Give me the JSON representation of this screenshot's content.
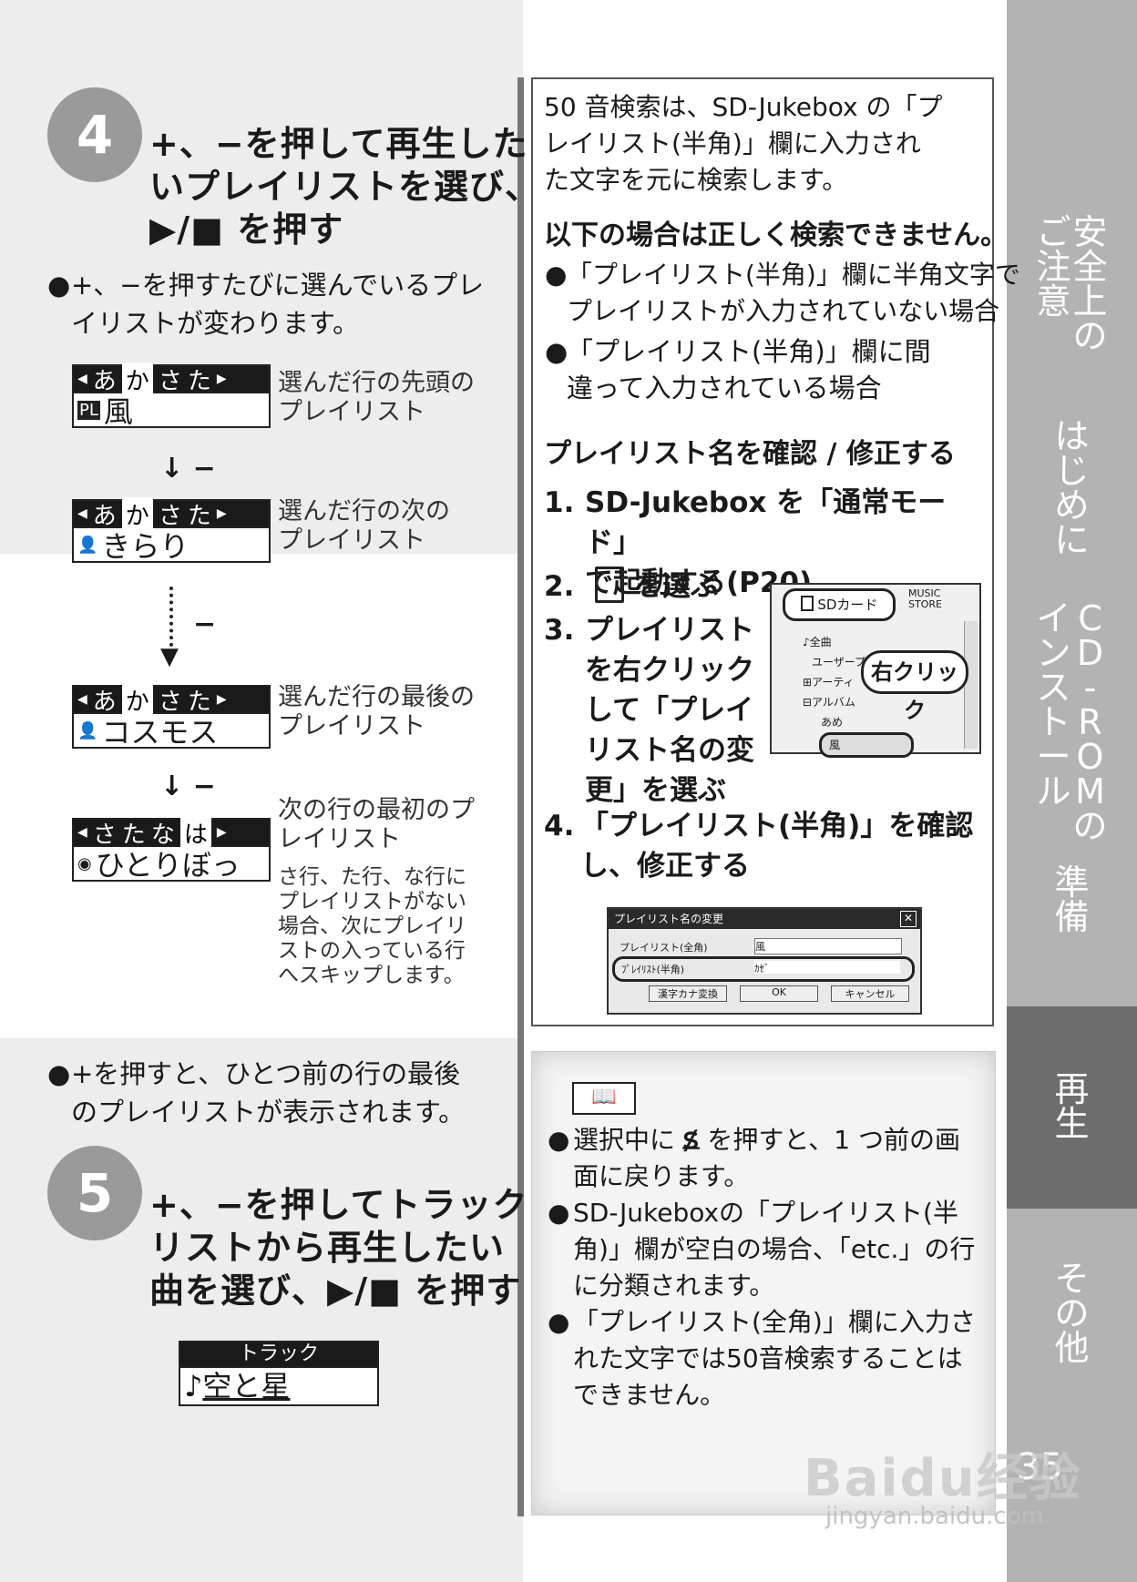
{
  "steps": {
    "step4": {
      "number": "4",
      "title_lines": [
        "+、−を押して再生した",
        "いプレイリストを選び、",
        "▶/■ を押す"
      ],
      "bullet": [
        "+、−を押すたびに選んでいるプレ",
        "イリストが変わります。"
      ]
    },
    "step5": {
      "number": "5",
      "title_lines": [
        "+、−を押してトラック",
        "リストから再生したい",
        "曲を選び、▶/■ を押す"
      ]
    }
  },
  "lcd_examples": [
    {
      "top_left": "◀",
      "chars": [
        "あ",
        "か",
        "さ",
        "た"
      ],
      "selected": 1,
      "top_right": "▶",
      "icon": "PL",
      "text": "風",
      "note": [
        "選んだ行の先頭の",
        "プレイリスト"
      ]
    },
    {
      "top_left": "◀",
      "chars": [
        "あ",
        "か",
        "さ",
        "た"
      ],
      "selected": 1,
      "top_right": "▶",
      "icon": "👤",
      "text": "きらり",
      "note": [
        "選んだ行の次の",
        "プレイリスト"
      ]
    },
    {
      "top_left": "◀",
      "chars": [
        "あ",
        "か",
        "さ",
        "た"
      ],
      "selected": 1,
      "top_right": "▶",
      "icon": "👤",
      "text": "コスモス",
      "note": [
        "選んだ行の最後の",
        "プレイリスト"
      ]
    },
    {
      "top_left": "◀",
      "chars": [
        "さ",
        "た",
        "な",
        "は"
      ],
      "selected": 3,
      "top_right": "▶",
      "icon": "◉",
      "text": "ひとりぼっ",
      "note": [
        "次の行の最初のプ",
        "レイリスト"
      ],
      "small_note": [
        "さ行、た行、な行に",
        "プレイリストがない",
        "場合、次にプレイリ",
        "ストの入っている行",
        "へスキップします。"
      ]
    }
  ],
  "arrows": {
    "minus1": "−",
    "minus2": "−",
    "minus3": "−"
  },
  "bullet_plus": [
    "+を押すと、ひとつ前の行の最後",
    "のプレイリストが表示されます。"
  ],
  "track_lcd": {
    "header": "トラック",
    "icon": "♪",
    "text": "空と星"
  },
  "info_box": {
    "intro": [
      "50 音検索は、SD-Jukebox の「プ",
      "レイリスト(半角)」欄に入力され",
      "た文字を元に検索します。"
    ],
    "warn_title": "以下の場合は正しく検索できません。",
    "warn_items": [
      [
        "「プレイリスト(半角)」欄に半角文字で",
        "プレイリストが入力されていない場合"
      ],
      [
        "「プレイリスト(半角)」欄に間",
        "違って入力されている場合"
      ]
    ],
    "section_title": "プレイリスト名を確認 / 修正する",
    "procedure": [
      {
        "n": "1.",
        "lines": [
          "SD-Jukebox を「通常モード」",
          "で起動する(P20)"
        ]
      },
      {
        "n": "2.",
        "lines": [
          "を選ぶ"
        ]
      },
      {
        "n": "3.",
        "lines": [
          "プレイリスト",
          "を右クリック",
          "して「プレイ",
          "リスト名の変",
          "更」を選ぶ"
        ]
      },
      {
        "n": "4.",
        "lines": [
          "「プレイリスト(半角)」を確認",
          "し、修正する"
        ]
      }
    ],
    "screenshot1": {
      "tab1": "SDカード",
      "tab2a": "MUSIC",
      "tab2b": "STORE",
      "items": [
        "♪全曲",
        "ユーザープレイリスト",
        "⊞アーティ",
        "⊟アルバム",
        "あめ",
        "風"
      ],
      "callout": "右クリック"
    },
    "screenshot2": {
      "title": "プレイリスト名の変更",
      "row1_label": "プレイリスト(全角)",
      "row1_value": "風",
      "row2_label": "ﾌﾟﾚｲﾘｽﾄ(半角)",
      "row2_value": "ｶｾﾞ",
      "buttons": [
        "漢字カナ変換",
        "OK",
        "キャンセル"
      ]
    }
  },
  "memo": {
    "items": [
      [
        "選択中に",
        "を押すと、1 つ前の画",
        "面に戻ります。"
      ],
      [
        "SD-Jukeboxの「プレイリスト(半",
        "角)」欄が空白の場合、「etc.」の行",
        "に分類されます。"
      ],
      [
        "「プレイリスト(全角)」欄に入力さ",
        "れた文字では50音検索することは",
        "できません。"
      ]
    ]
  },
  "side_tabs": [
    {
      "id": "safety",
      "cols": [
        [
          "安",
          "全",
          "上",
          "の"
        ],
        [
          "ご",
          "注",
          "意"
        ]
      ]
    },
    {
      "id": "intro",
      "cols": [
        [
          "は",
          "じ",
          "め",
          "に"
        ]
      ]
    },
    {
      "id": "cdrom",
      "cols": [
        [
          "C",
          "D",
          "-",
          "R",
          "O",
          "M",
          "の"
        ],
        [
          "イ",
          "ン",
          "ス",
          "ト",
          "ー",
          "ル"
        ]
      ]
    },
    {
      "id": "prep",
      "cols": [
        [
          "準",
          "備"
        ]
      ]
    },
    {
      "id": "play",
      "cols": [
        [
          "再",
          "生"
        ]
      ]
    },
    {
      "id": "other",
      "cols": [
        [
          "そ",
          "の",
          "他"
        ]
      ]
    }
  ],
  "page_number": "35",
  "watermark": {
    "brand": "Bai",
    "brand2": "du",
    "cn": "经验",
    "url": "jingyan.baidu.com"
  },
  "colors": {
    "gray_bg": "#ededed",
    "sidebar": "#b3b3b3",
    "active_tab": "#6d6d6d",
    "step_circle": "#9a9a9a"
  }
}
